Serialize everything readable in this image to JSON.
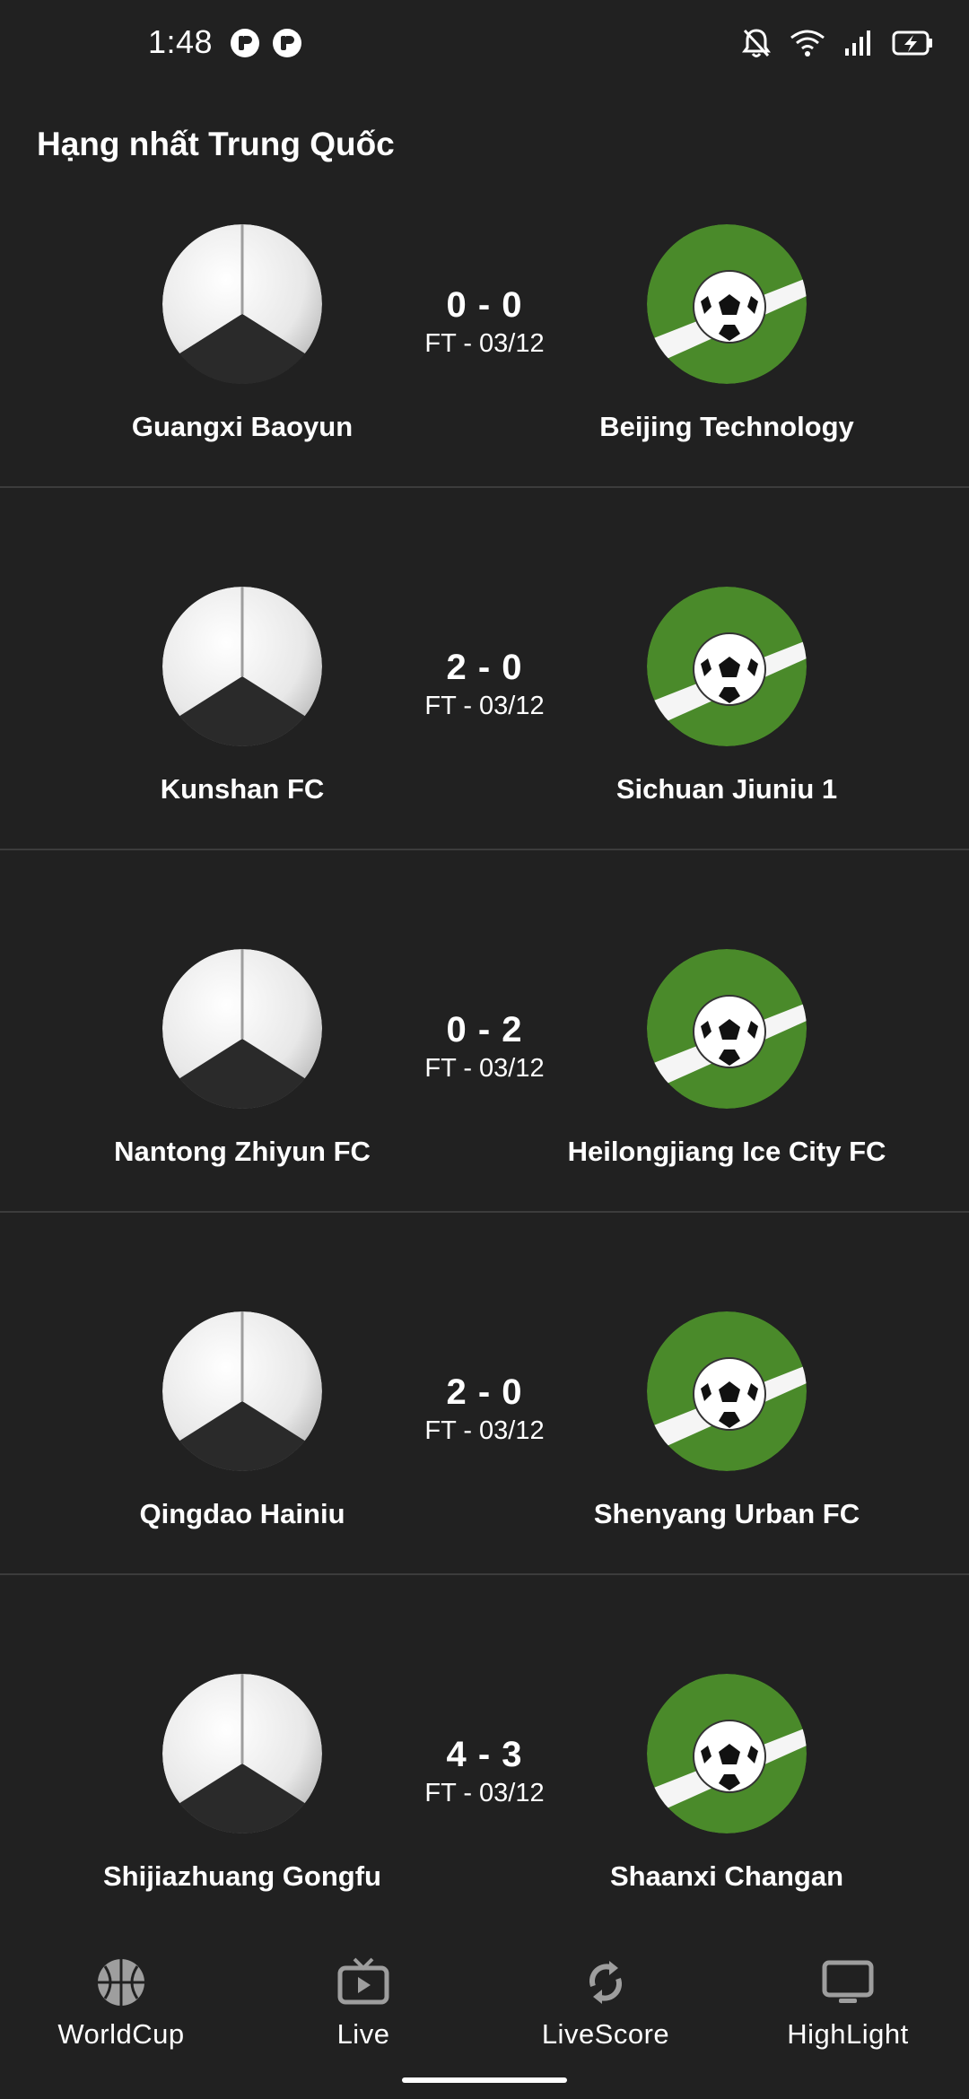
{
  "status_bar": {
    "time": "1:48",
    "icons": [
      "app-notification-icon",
      "app-notification-icon",
      "bell-off-icon",
      "wifi-icon",
      "cellular-signal-icon",
      "battery-charging-icon"
    ]
  },
  "league": {
    "title": "Hạng nhất Trung Quốc"
  },
  "matches": [
    {
      "home": "Guangxi Baoyun",
      "away": "Beijing Technology",
      "score": "0 - 0",
      "status": "FT - 03/12"
    },
    {
      "home": "Kunshan FC",
      "away": "Sichuan Jiuniu 1",
      "score": "2 - 0",
      "status": "FT - 03/12"
    },
    {
      "home": "Nantong Zhiyun FC",
      "away": "Heilongjiang Ice City FC",
      "score": "0 - 2",
      "status": "FT - 03/12"
    },
    {
      "home": "Qingdao Hainiu",
      "away": "Shenyang Urban FC",
      "score": "2 - 0",
      "status": "FT - 03/12"
    },
    {
      "home": "Shijiazhuang Gongfu",
      "away": "Shaanxi Changan",
      "score": "4 - 3",
      "status": "FT - 03/12"
    }
  ],
  "bottom_nav": {
    "items": [
      {
        "label": "WorldCup",
        "icon": "basketball-icon"
      },
      {
        "label": "Live",
        "icon": "tv-play-icon"
      },
      {
        "label": "LiveScore",
        "icon": "refresh-icon"
      },
      {
        "label": "HighLight",
        "icon": "monitor-icon"
      }
    ]
  },
  "colors": {
    "background": "#212121",
    "divider": "#3c3c3c",
    "text": "#ffffff",
    "nav_icon": "#9e9e9e"
  }
}
